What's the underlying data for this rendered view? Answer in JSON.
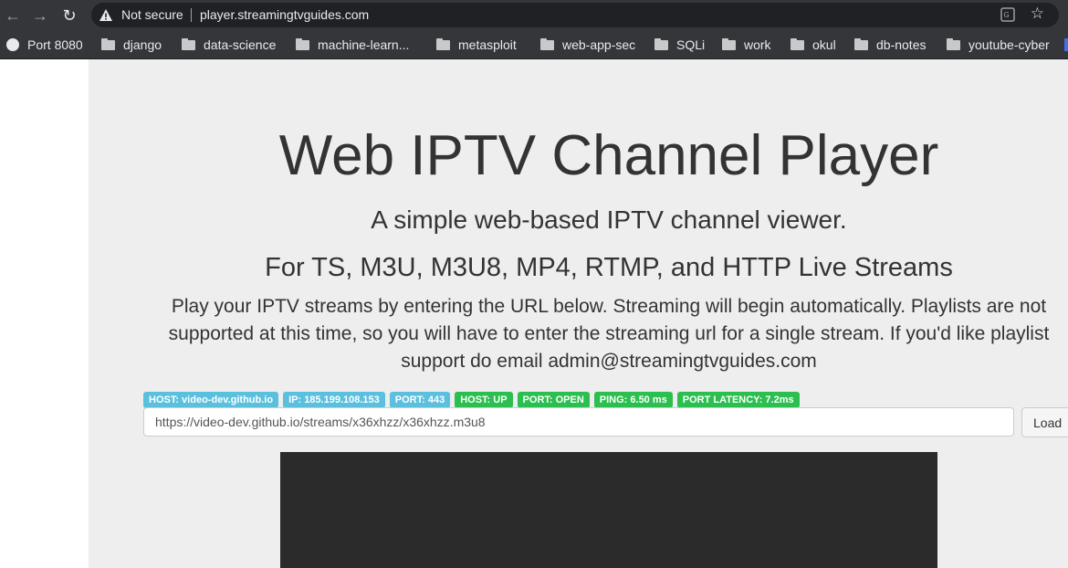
{
  "browser": {
    "not_secure_label": "Not secure",
    "url": "player.streamingtvguides.com",
    "bookmarks": [
      {
        "label": "Port 8080",
        "icon": "globe-icon"
      },
      {
        "label": "django",
        "icon": "folder-icon"
      },
      {
        "label": "data-science",
        "icon": "folder-icon"
      },
      {
        "label": "machine-learn...",
        "icon": "folder-icon"
      },
      {
        "label": "metasploit",
        "icon": "folder-icon"
      },
      {
        "label": "web-app-sec",
        "icon": "folder-icon"
      },
      {
        "label": "SQLi",
        "icon": "folder-icon"
      },
      {
        "label": "work",
        "icon": "folder-icon"
      },
      {
        "label": "okul",
        "icon": "folder-icon"
      },
      {
        "label": "db-notes",
        "icon": "folder-icon"
      },
      {
        "label": "youtube-cyber",
        "icon": "folder-icon"
      }
    ]
  },
  "page": {
    "title": "Web IPTV Channel Player",
    "subtitle": "A simple web-based IPTV channel viewer.",
    "formats": "For TS, M3U, M3U8, MP4, RTMP, and HTTP Live Streams",
    "description": "Play your IPTV streams by entering the URL below. Streaming will begin automatically. Playlists are not supported at this time, so you will have to enter the streaming url for a single stream. If you'd like playlist support do email admin@streamingtvguides.com",
    "badges": [
      {
        "label": "HOST: video-dev.github.io",
        "style": "info"
      },
      {
        "label": "IP: 185.199.108.153",
        "style": "info"
      },
      {
        "label": "PORT: 443",
        "style": "info"
      },
      {
        "label": "HOST: UP",
        "style": "success"
      },
      {
        "label": "PORT: OPEN",
        "style": "success"
      },
      {
        "label": "PING: 6.50 ms",
        "style": "success"
      },
      {
        "label": "PORT LATENCY: 7.2ms",
        "style": "success"
      }
    ],
    "stream_url": "https://video-dev.github.io/streams/x36xhzz/x36xhzz.m3u8",
    "load_label": "Load"
  },
  "colors": {
    "badge_info": "#5bc0de",
    "badge_success": "#2bbf4f",
    "jumbotron_bg": "#eeeeee",
    "video_bg": "#2b2b2b"
  }
}
